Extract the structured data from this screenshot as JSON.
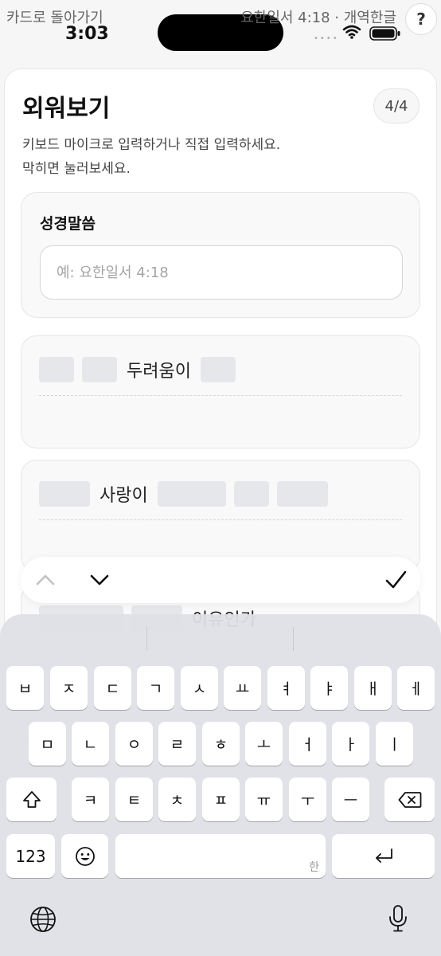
{
  "status_bar": {
    "back_link": "카드로 돌아가기",
    "time": "3:03",
    "header_reference": "요한일서 4:18 · 개역한글",
    "help_label": "?"
  },
  "card": {
    "title": "외워보기",
    "progress": "4/4",
    "instructions": [
      "키보드 마이크로 입력하거나 직접 입력하세요.",
      "막히면 눌러보세요."
    ]
  },
  "reference": {
    "label": "성경말씀",
    "placeholder": "예: 요한일서 4:18",
    "value": ""
  },
  "verse_lines": [
    {
      "word": "두려움이"
    },
    {
      "word": "사랑이"
    },
    {
      "word": "이유인가"
    }
  ],
  "keyboard": {
    "row1": [
      "ㅂ",
      "ㅈ",
      "ㄷ",
      "ㄱ",
      "ㅅ",
      "ㅛ",
      "ㅕ",
      "ㅑ",
      "ㅐ",
      "ㅔ"
    ],
    "row2": [
      "ㅁ",
      "ㄴ",
      "ㅇ",
      "ㄹ",
      "ㅎ",
      "ㅗ",
      "ㅓ",
      "ㅏ",
      "ㅣ"
    ],
    "row3": [
      "ㅋ",
      "ㅌ",
      "ㅊ",
      "ㅍ",
      "ㅠ",
      "ㅜ",
      "ㅡ"
    ],
    "numbers_label": "123",
    "space_hint": "한",
    "icons": {
      "shift": "shift-icon",
      "delete": "backspace-icon",
      "emoji": "emoji-icon",
      "return": "return-icon",
      "globe": "globe-icon",
      "mic": "microphone-icon"
    }
  },
  "accessory": {
    "icons": [
      "chevron-up-icon",
      "chevron-down-icon",
      "checkmark-icon"
    ]
  }
}
